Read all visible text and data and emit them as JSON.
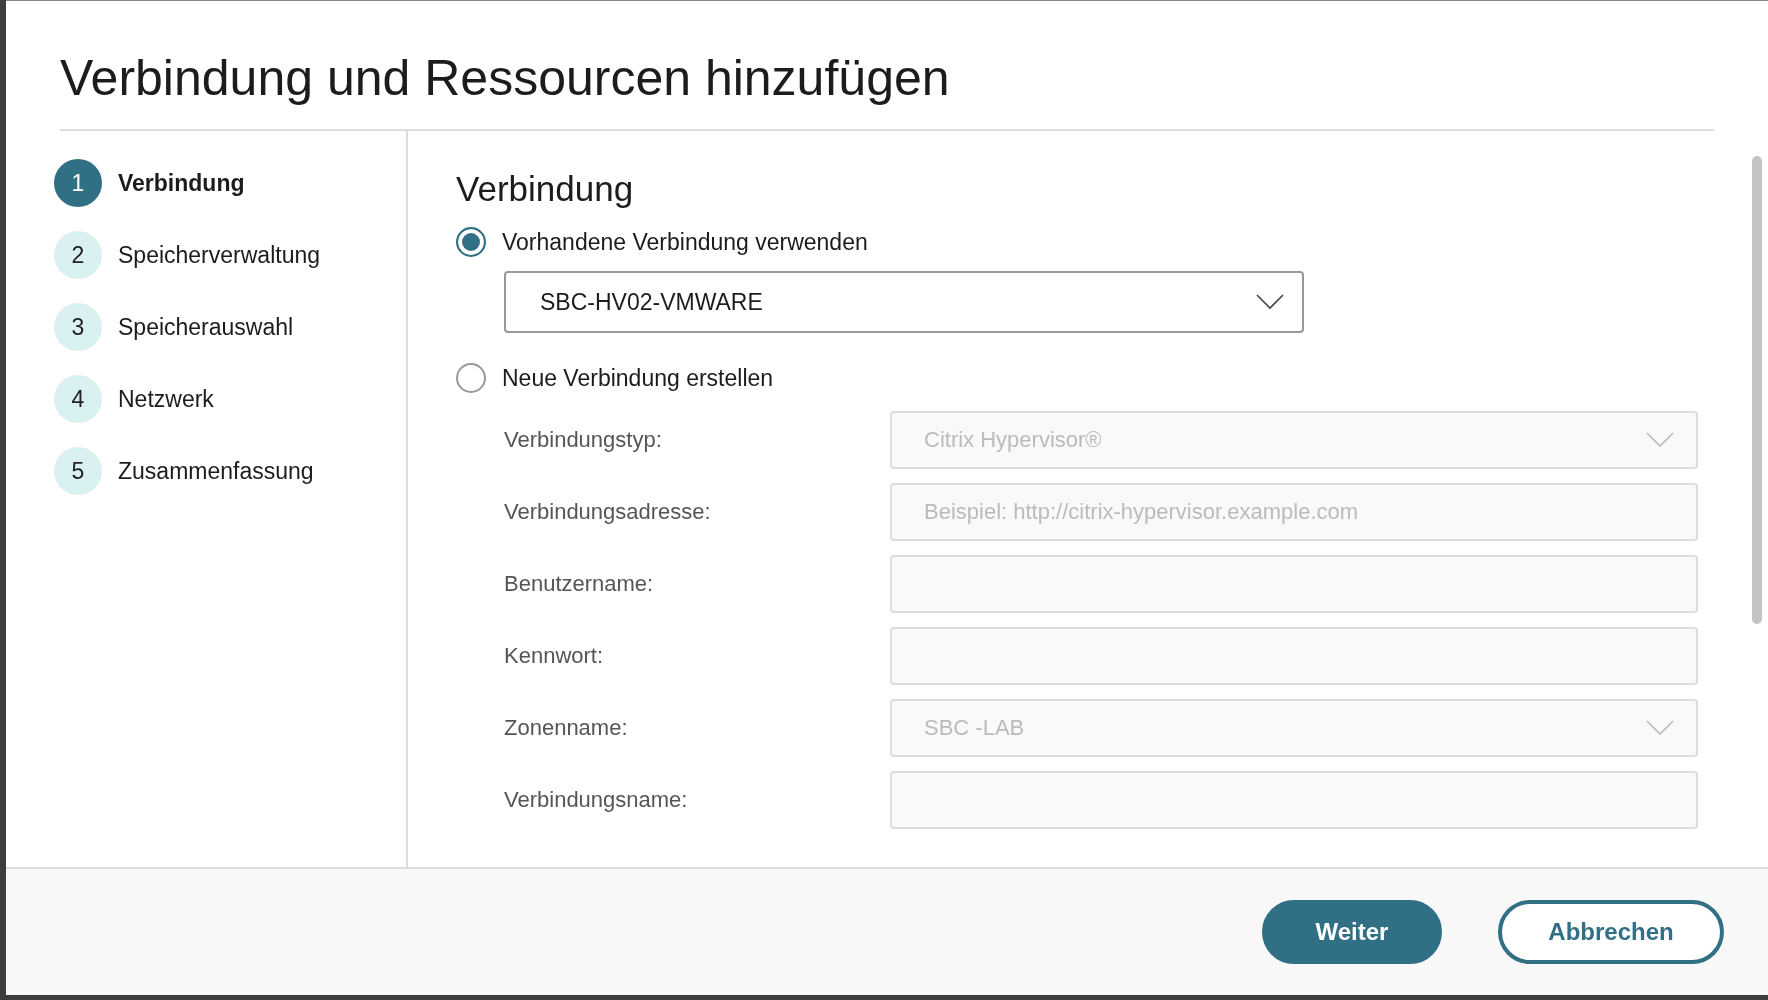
{
  "dialog": {
    "title": "Verbindung und Ressourcen hinzufügen"
  },
  "steps": [
    {
      "number": "1",
      "label": "Verbindung",
      "selected": true
    },
    {
      "number": "2",
      "label": "Speicherverwaltung",
      "selected": false
    },
    {
      "number": "3",
      "label": "Speicherauswahl",
      "selected": false
    },
    {
      "number": "4",
      "label": "Netzwerk",
      "selected": false
    },
    {
      "number": "5",
      "label": "Zusammenfassung",
      "selected": false
    }
  ],
  "section": {
    "heading": "Verbindung",
    "options": [
      {
        "label": "Vorhandene Verbindung verwenden",
        "selected": true,
        "dropdown": {
          "value": "SBC-HV02-VMWARE"
        }
      },
      {
        "label": "Neue Verbindung erstellen",
        "selected": false
      }
    ],
    "fields": [
      {
        "label": "Verbindungstyp:",
        "kind": "select",
        "value": "Citrix Hypervisor®",
        "disabled": true
      },
      {
        "label": "Verbindungsadresse:",
        "kind": "text",
        "placeholder": "Beispiel: http://citrix-hypervisor.example.com",
        "disabled": true
      },
      {
        "label": "Benutzername:",
        "kind": "text",
        "disabled": true
      },
      {
        "label": "Kennwort:",
        "kind": "text",
        "disabled": true
      },
      {
        "label": "Zonenname:",
        "kind": "select",
        "value": "SBC -LAB",
        "disabled": true
      },
      {
        "label": "Verbindungsname:",
        "kind": "text",
        "disabled": true
      }
    ]
  },
  "buttons": [
    {
      "label": "Weiter",
      "kind": "primary"
    },
    {
      "label": "Abbrechen",
      "kind": "secondary"
    }
  ]
}
